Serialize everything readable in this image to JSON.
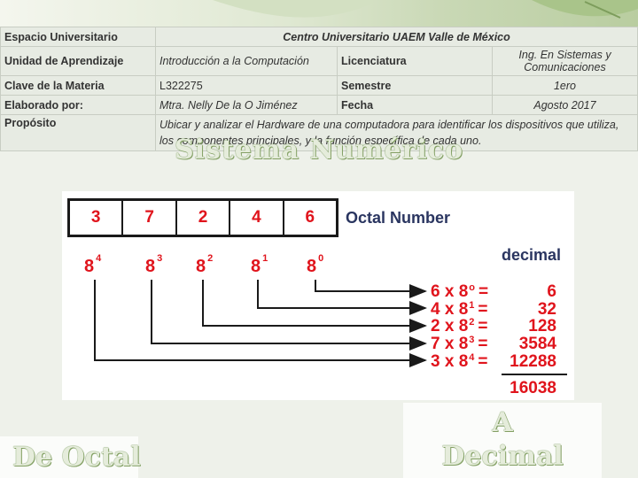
{
  "header": {
    "rows": [
      {
        "label": "Espacio Universitario",
        "value": "Centro Universitario UAEM Valle de México"
      },
      {
        "label": "Unidad de Aprendizaje",
        "value": "Introducción a la Computación",
        "label2": "Licenciatura",
        "value2": "Ing. En Sistemas y Comunicaciones"
      },
      {
        "label": "Clave de la Materia",
        "value": "L322275",
        "label2": "Semestre",
        "value2": "1ero"
      },
      {
        "label": "Elaborado por:",
        "value": "Mtra. Nelly De la O Jiménez",
        "label2": "Fecha",
        "value2": "Agosto 2017"
      },
      {
        "label": "Propósito",
        "value": "Ubicar y analizar el  Hardware de una computadora para identificar los dispositivos que utiliza, los componentes principales, y la función específica de cada uno."
      }
    ]
  },
  "title": "Sistema Numérico",
  "diagram": {
    "digits": [
      "3",
      "7",
      "2",
      "4",
      "6"
    ],
    "octal_label": "Octal Number",
    "decimal_label": "decimal",
    "powers": [
      {
        "base": "8",
        "exp": "4"
      },
      {
        "base": "8",
        "exp": "3"
      },
      {
        "base": "8",
        "exp": "2"
      },
      {
        "base": "8",
        "exp": "1"
      },
      {
        "base": "8",
        "exp": "0"
      }
    ],
    "terms": [
      {
        "lhs": "6 x 8",
        "exp": "o",
        "eq": "=",
        "result": "6"
      },
      {
        "lhs": "4 x 8",
        "exp": "1",
        "eq": "=",
        "result": "32"
      },
      {
        "lhs": "2 x 8",
        "exp": "2",
        "eq": "=",
        "result": "128"
      },
      {
        "lhs": "7 x 8",
        "exp": "3",
        "eq": "=",
        "result": "3584"
      },
      {
        "lhs": "3 x 8",
        "exp": "4",
        "eq": "=",
        "result": "12288"
      }
    ],
    "total": "16038"
  },
  "labels": {
    "from": "De Octal",
    "a": "A",
    "to": "Decimal"
  }
}
